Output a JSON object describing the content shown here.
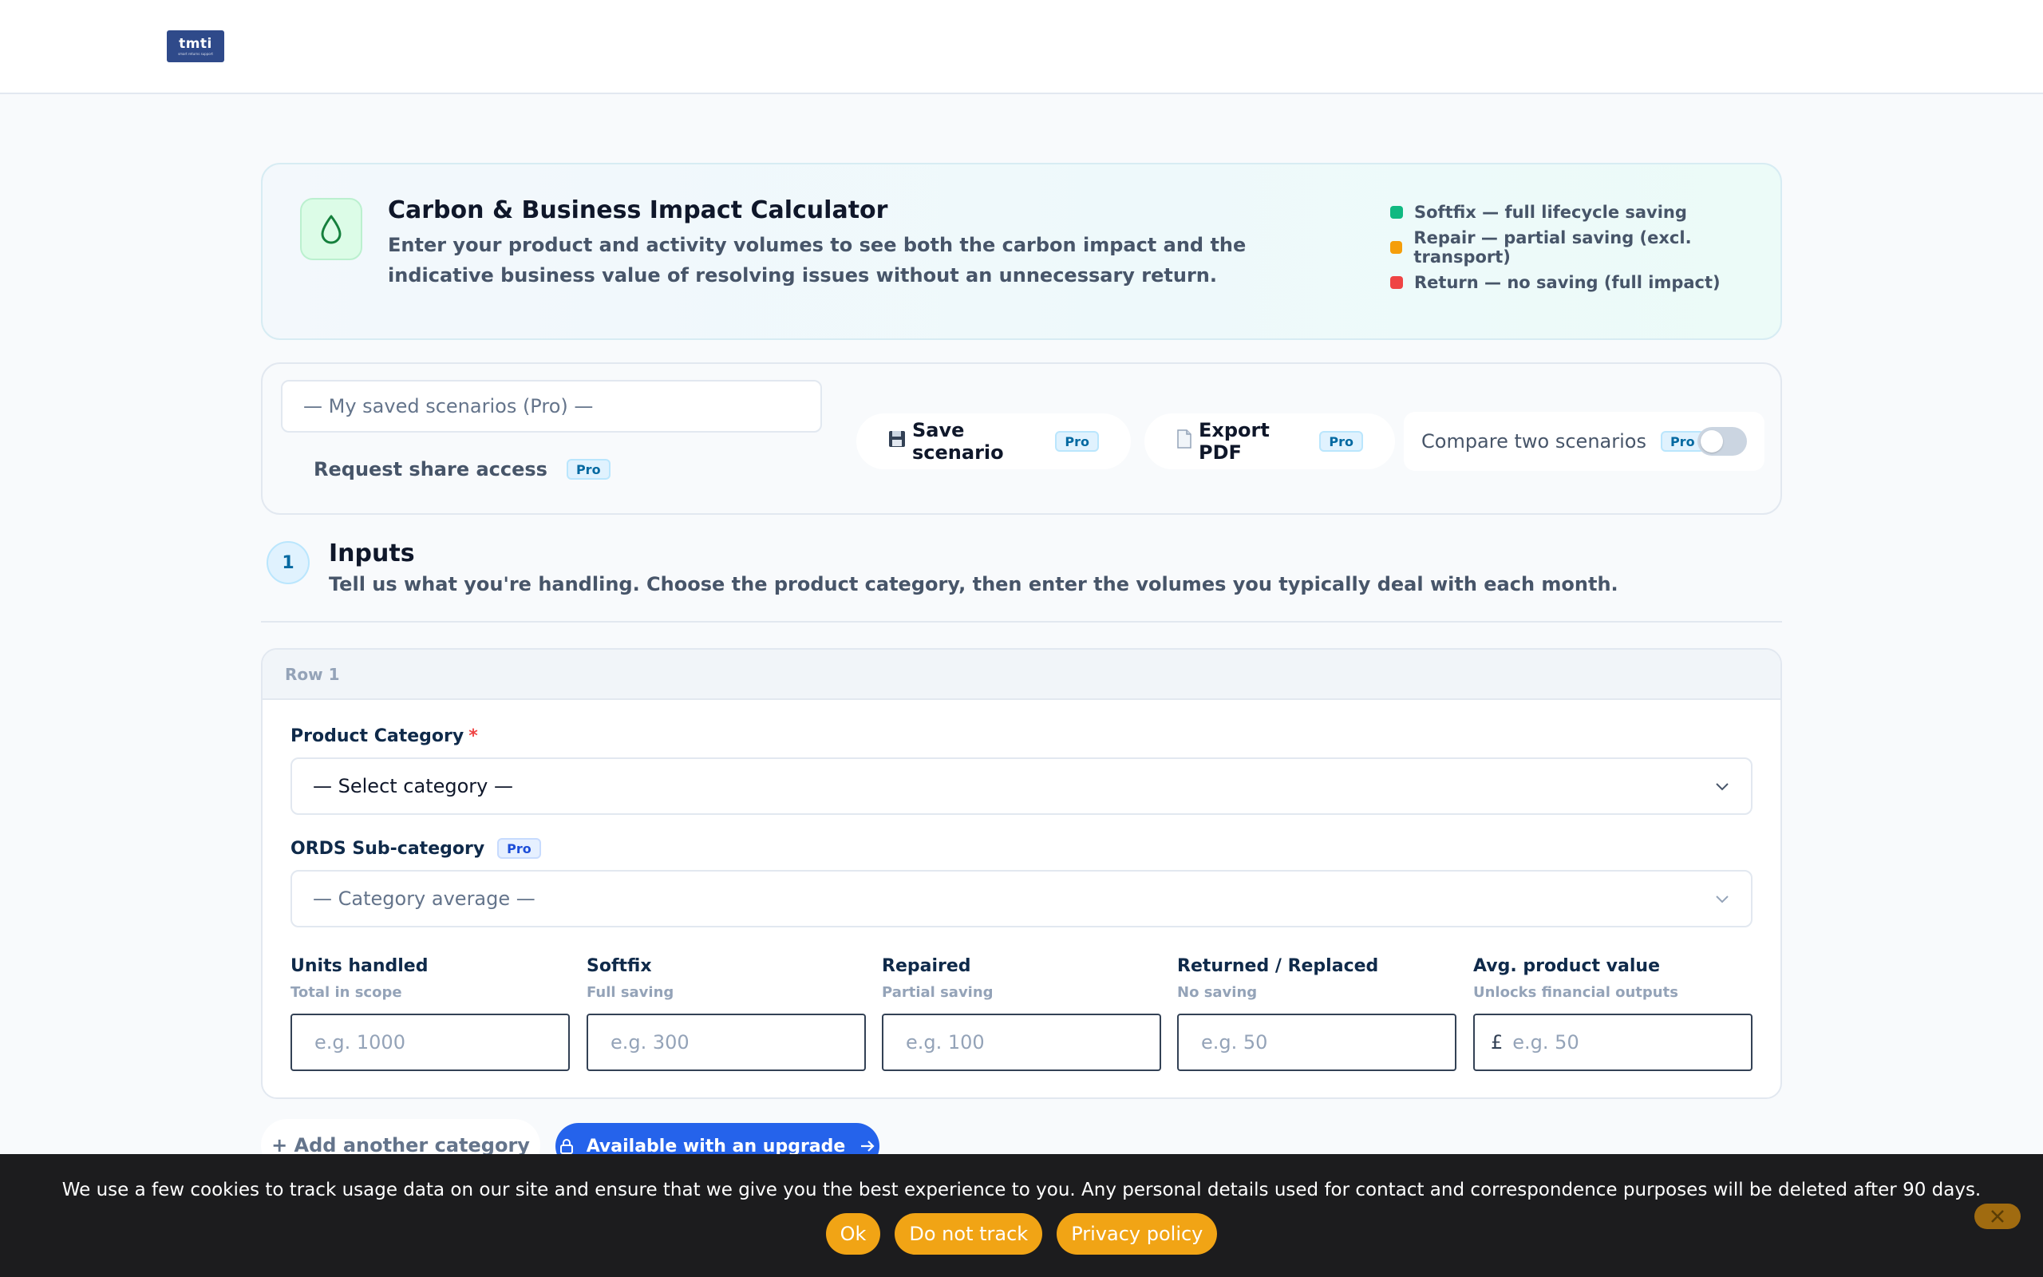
{
  "header": {
    "logo_text": "tmti",
    "logo_tagline": "smart returns support"
  },
  "hero": {
    "title": "Carbon & Business Impact Calculator",
    "description": "Enter your product and activity volumes to see both the carbon impact and the indicative business value of resolving issues without an unnecessary return.",
    "icon": "droplet-icon",
    "legend": [
      {
        "label": "Softfix — full lifecycle saving",
        "color": "#10b981"
      },
      {
        "label": "Repair — partial saving (excl. transport)",
        "color": "#f59e0b"
      },
      {
        "label": "Return — no saving (full impact)",
        "color": "#ef4444"
      }
    ]
  },
  "toolbar": {
    "saved_scenarios_placeholder": "— My saved scenarios (Pro) —",
    "share_label": "Request share access",
    "save_label": "Save scenario",
    "export_label": "Export PDF",
    "compare_label": "Compare two scenarios",
    "pro_badge": "Pro",
    "compare_on": false
  },
  "section": {
    "step": "1",
    "title": "Inputs",
    "subtitle": "Tell us what you're handling. Choose the product category, then enter the volumes you typically deal with each month."
  },
  "row": {
    "header": "Row 1",
    "category_label": "Product Category",
    "required_mark": "*",
    "category_value": "— Select category —",
    "subcategory_label": "ORDS Sub-category",
    "subcategory_value": "— Category average —",
    "fields": [
      {
        "label": "Units handled",
        "hint": "Total in scope",
        "placeholder": "e.g. 1000"
      },
      {
        "label": "Softfix",
        "hint": "Full saving",
        "placeholder": "e.g. 300"
      },
      {
        "label": "Repaired",
        "hint": "Partial saving",
        "placeholder": "e.g. 100"
      },
      {
        "label": "Returned / Replaced",
        "hint": "No saving",
        "placeholder": "e.g. 50"
      },
      {
        "label": "Avg. product value",
        "hint": "Unlocks financial outputs",
        "placeholder": "e.g. 50",
        "currency": "£"
      }
    ]
  },
  "actions": {
    "add_label": "+ Add another category",
    "upgrade_label": "Available with an upgrade"
  },
  "cookie": {
    "text": "We use a few cookies to track usage data on our site and ensure that we give you the best experience to you. Any personal details used for contact and correspondence purposes will be deleted after 90 days.",
    "ok_label": "Ok",
    "do_not_track_label": "Do not track",
    "privacy_label": "Privacy policy"
  },
  "colors": {
    "accent": "#2563eb",
    "cookie_button": "#f1a415"
  }
}
